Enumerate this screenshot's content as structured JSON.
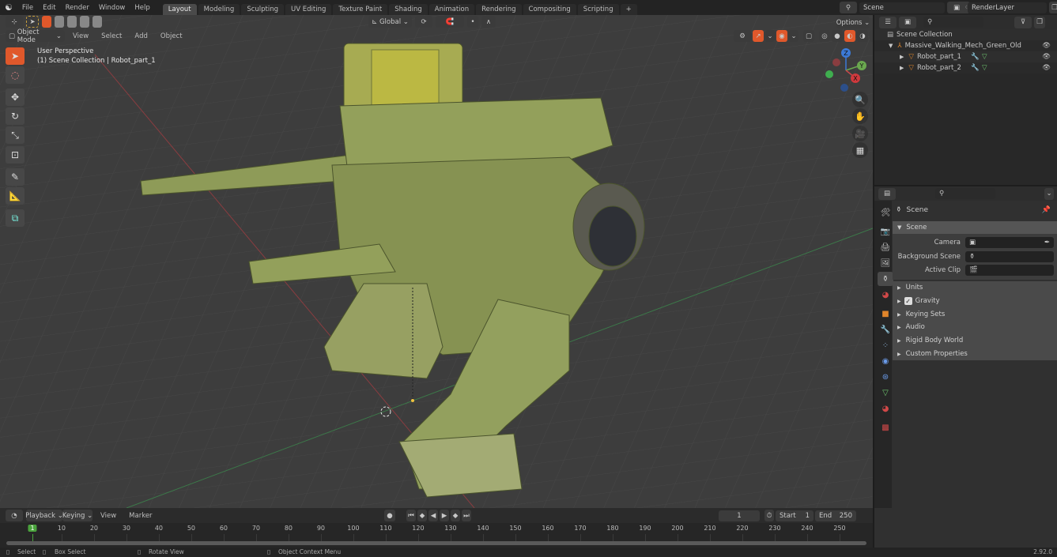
{
  "app": {
    "version": "2.92.0"
  },
  "topbar": {
    "menus": [
      "File",
      "Edit",
      "Render",
      "Window",
      "Help"
    ],
    "workspaces": [
      "Layout",
      "Modeling",
      "Sculpting",
      "UV Editing",
      "Texture Paint",
      "Shading",
      "Animation",
      "Rendering",
      "Compositing",
      "Scripting"
    ],
    "active_workspace": "Layout",
    "add_tab": "+",
    "scene_name": "Scene",
    "view_layer": "RenderLayer"
  },
  "viewport": {
    "mode": "Object Mode",
    "menus": [
      "View",
      "Select",
      "Add",
      "Object"
    ],
    "orientation": "Global",
    "options_label": "Options",
    "overlay_text_line1": "User Perspective",
    "overlay_text_line2": "(1) Scene Collection | Robot_part_1",
    "gizmo": {
      "x": "X",
      "y": "Y",
      "z": "Z"
    },
    "colors": {
      "x_axis": "#c8464a",
      "y_axis": "#6aa84f",
      "z_axis": "#3c7ad6",
      "active_tool": "#e0582b"
    }
  },
  "outliner": {
    "root": "Scene Collection",
    "items": [
      {
        "name": "Massive_Walking_Mech_Green_Old",
        "level": 1
      },
      {
        "name": "Robot_part_1",
        "level": 2
      },
      {
        "name": "Robot_part_2",
        "level": 2
      }
    ]
  },
  "properties": {
    "context": "Scene",
    "section_scene": "Scene",
    "fields": [
      {
        "label": "Camera",
        "value": ""
      },
      {
        "label": "Background Scene",
        "value": ""
      },
      {
        "label": "Active Clip",
        "value": ""
      }
    ],
    "panels": [
      {
        "label": "Units",
        "checkbox": false
      },
      {
        "label": "Gravity",
        "checkbox": true,
        "checked": true
      },
      {
        "label": "Keying Sets",
        "checkbox": false
      },
      {
        "label": "Audio",
        "checkbox": false
      },
      {
        "label": "Rigid Body World",
        "checkbox": false
      },
      {
        "label": "Custom Properties",
        "checkbox": false
      }
    ]
  },
  "timeline": {
    "menus": [
      "Playback",
      "Keying",
      "View",
      "Marker"
    ],
    "current_frame": "1",
    "start_label": "Start",
    "start": "1",
    "end_label": "End",
    "end": "250",
    "ticks": [
      "1",
      "10",
      "20",
      "30",
      "40",
      "50",
      "60",
      "70",
      "80",
      "90",
      "100",
      "110",
      "120",
      "130",
      "140",
      "150",
      "160",
      "170",
      "180",
      "190",
      "200",
      "210",
      "220",
      "230",
      "240",
      "250"
    ]
  },
  "statusbar": {
    "items": [
      "Select",
      "Box Select",
      "Rotate View",
      "Object Context Menu"
    ]
  }
}
